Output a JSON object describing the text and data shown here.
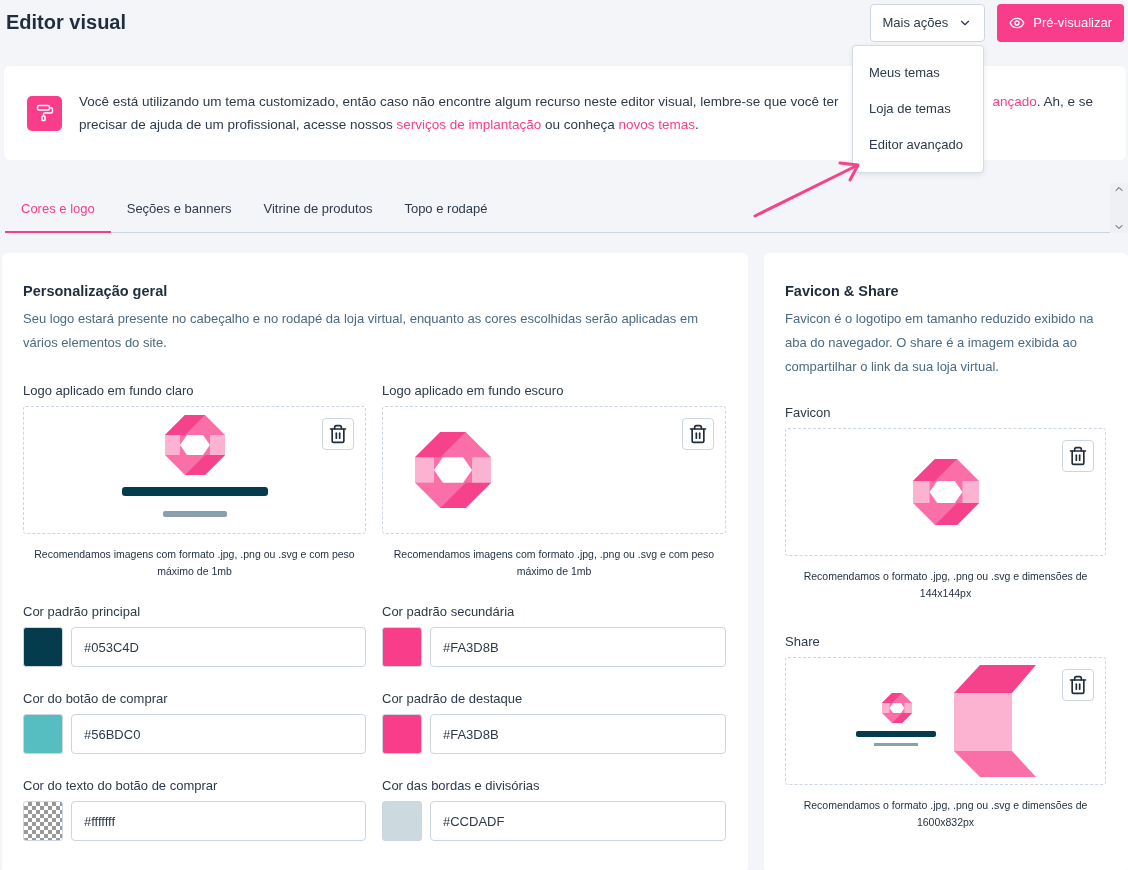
{
  "header": {
    "title": "Editor visual",
    "more_button": {
      "label": "Mais ações",
      "expanded": true
    },
    "preview_button": "Pré-visualizar"
  },
  "menu": {
    "items": [
      "Meus temas",
      "Loja de temas",
      "Editor avançado"
    ]
  },
  "notice": {
    "first_line": [
      {
        "kind": "text",
        "text": "Você está utilizando um tema customizado, então caso não encontre algum recurso neste editor visual, lembre-se que você ter"
      },
      {
        "kind": "link",
        "text": "ançado"
      },
      {
        "kind": "text",
        "text": ". Ah, e se"
      }
    ],
    "parts": [
      {
        "kind": "text",
        "text": "precisar de ajuda de um profissional, acesse nossos "
      },
      {
        "kind": "link",
        "text": "serviços de implantação"
      },
      {
        "kind": "text",
        "text": " ou conheça "
      },
      {
        "kind": "link",
        "text": "novos temas"
      },
      {
        "kind": "text",
        "text": "."
      }
    ]
  },
  "tabs": [
    {
      "label": "Cores e logo",
      "selected": true
    },
    {
      "label": "Seções e banners",
      "selected": false
    },
    {
      "label": "Vitrine de produtos",
      "selected": false
    },
    {
      "label": "Topo e rodapé",
      "selected": false
    }
  ],
  "general": {
    "title": "Personalização geral",
    "description": "Seu logo estará presente no cabeçalho e no rodapé da loja virtual, enquanto as cores escolhidas serão aplicadas em vários elementos do site.",
    "logos": [
      {
        "label": "Logo aplicado em fundo claro",
        "kind": "picture",
        "note": "Recomendamos imagens com formato .jpg, .png ou .svg e com peso máximo de 1mb"
      },
      {
        "label": "Logo aplicado em fundo escuro",
        "kind": "picture",
        "note": "Recomendamos imagens com formato .jpg, .png ou .svg e com peso máximo de 1mb"
      }
    ],
    "colors": [
      {
        "label": "Cor padrão principal",
        "value": "#053C4D",
        "kind": "solid",
        "color": "#053c4d"
      },
      {
        "label": "Cor padrão secundária",
        "value": "#FA3D8B",
        "kind": "solid",
        "color": "#fa3d8b"
      },
      {
        "label": "Cor do botão de comprar",
        "value": "#56BDC0",
        "kind": "solid",
        "color": "#56bdc0"
      },
      {
        "label": "Cor padrão de destaque",
        "value": "#FA3D8B",
        "kind": "solid",
        "color": "#fa3d8b"
      },
      {
        "label": "Cor do texto do botão de comprar",
        "value": "#fffffff",
        "kind": "checker"
      },
      {
        "label": "Cor das bordas e divisórias",
        "value": "#CCDADF",
        "kind": "solid",
        "color": "#ccdadf"
      }
    ]
  },
  "favicon_share": {
    "title": "Favicon & Share",
    "description": "Favicon é o logotipo em tamanho reduzido exibido na aba do navegador. O share é a imagem exibida ao compartilhar o link da sua loja virtual.",
    "uploads": [
      {
        "label": "Favicon",
        "kind": "picture",
        "note": "Recomendamos o formato .jpg, .png ou .svg e dimensões de 144x144px"
      },
      {
        "label": "Share",
        "kind": "picture",
        "note": "Recomendamos o formato .jpg, .png ou .svg e dimensões de 1600x832px"
      }
    ]
  }
}
